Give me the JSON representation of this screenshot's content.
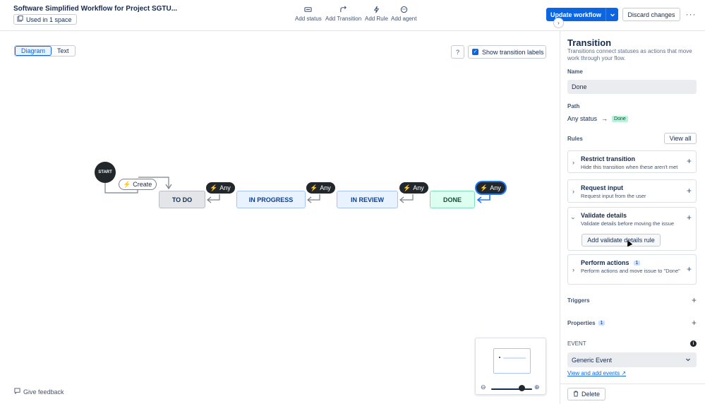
{
  "header": {
    "title": "Software Simplified Workflow for Project SGTU...",
    "used_in": "Used in 1 space",
    "tools": [
      {
        "label": "Add status",
        "icon": "status-icon"
      },
      {
        "label": "Add Transition",
        "icon": "transition-icon"
      },
      {
        "label": "Add Rule",
        "icon": "bolt-icon"
      },
      {
        "label": "Add agent",
        "icon": "agent-icon"
      }
    ],
    "update_label": "Update workflow",
    "discard_label": "Discard changes",
    "more_label": "···"
  },
  "canvas": {
    "view_tabs": [
      "Diagram",
      "Text"
    ],
    "active_view": "Diagram",
    "help_label": "?",
    "show_labels": "Show transition labels",
    "start_label": "START",
    "create_label": "Create",
    "statuses": [
      "TO DO",
      "IN PROGRESS",
      "IN REVIEW",
      "DONE"
    ],
    "any_label": "Any",
    "feedback_label": "Give feedback"
  },
  "panel": {
    "title": "Transition",
    "description": "Transitions connect statuses as actions that move work through your flow.",
    "name_label": "Name",
    "name_value": "Done",
    "path_label": "Path",
    "path_from": "Any status",
    "path_to": "Done",
    "rules_label": "Rules",
    "view_all_label": "View all",
    "rules": [
      {
        "title": "Restrict transition",
        "subtitle": "Hide this transition when these aren't met"
      },
      {
        "title": "Request input",
        "subtitle": "Request input from the user"
      },
      {
        "title": "Validate details",
        "subtitle": "Validate details before moving the issue",
        "action": "Add validate details rule"
      },
      {
        "title": "Perform actions",
        "count": "1",
        "subtitle": "Perform actions and move issue to \"Done\""
      }
    ],
    "triggers_label": "Triggers",
    "properties_label": "Properties",
    "properties_count": "1",
    "event_label": "EVENT",
    "event_value": "Generic Event",
    "event_link": "View and add events",
    "delete_label": "Delete"
  },
  "colors": {
    "primary": "#0c66e4",
    "todo": "#e4e5e8",
    "in_progress": "#e9f2ff",
    "done": "#dcfff1",
    "dark_node": "#22272b"
  }
}
